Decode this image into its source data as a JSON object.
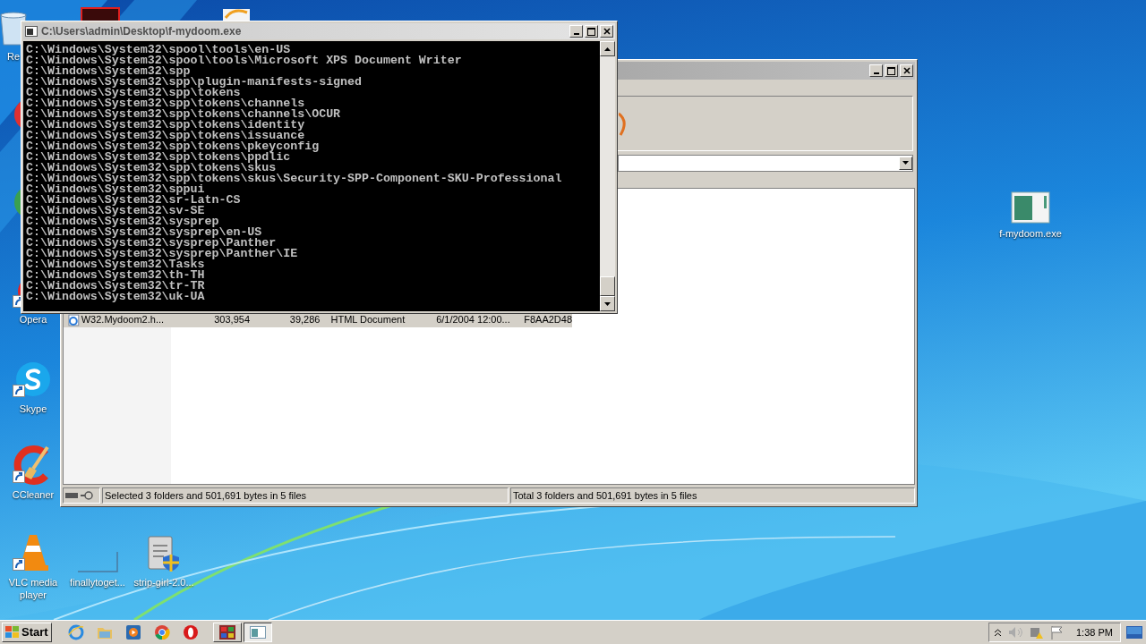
{
  "desktop_icons": [
    {
      "kind": "bin",
      "label": "Re"
    },
    {
      "kind": "opera",
      "label": "Opera"
    },
    {
      "kind": "skype",
      "label": "Skype"
    },
    {
      "kind": "ccleaner",
      "label": "CCleaner"
    },
    {
      "kind": "vlc",
      "label": "VLC media player"
    },
    {
      "kind": "blank",
      "label": "finallytoget..."
    },
    {
      "kind": "notepad",
      "label": "strip-girl-2.0..."
    },
    {
      "kind": "exe",
      "label": "f-mydoom.exe"
    }
  ],
  "file_window": {
    "rows": [
      {
        "selected": true,
        "name": "W32.Mydoom2.h...",
        "size": "303,954",
        "packed": "39,286",
        "type": "HTML Document",
        "date": "6/1/2004 12:00...",
        "crc": "F8AA2D48"
      }
    ],
    "status_bar": [
      "Selected 3 folders and 501,691 bytes in 5 files",
      "Total 3 folders and 501,691 bytes in 5 files"
    ]
  },
  "console": {
    "title": "C:\\Users\\admin\\Desktop\\f-mydoom.exe",
    "lines": [
      "C:\\Windows\\System32\\spool\\tools\\en-US",
      "C:\\Windows\\System32\\spool\\tools\\Microsoft XPS Document Writer",
      "C:\\Windows\\System32\\spp",
      "C:\\Windows\\System32\\spp\\plugin-manifests-signed",
      "C:\\Windows\\System32\\spp\\tokens",
      "C:\\Windows\\System32\\spp\\tokens\\channels",
      "C:\\Windows\\System32\\spp\\tokens\\channels\\OCUR",
      "C:\\Windows\\System32\\spp\\tokens\\identity",
      "C:\\Windows\\System32\\spp\\tokens\\issuance",
      "C:\\Windows\\System32\\spp\\tokens\\pkeyconfig",
      "C:\\Windows\\System32\\spp\\tokens\\ppdlic",
      "C:\\Windows\\System32\\spp\\tokens\\skus",
      "C:\\Windows\\System32\\spp\\tokens\\skus\\Security-SPP-Component-SKU-Professional",
      "C:\\Windows\\System32\\sppui",
      "C:\\Windows\\System32\\sr-Latn-CS",
      "C:\\Windows\\System32\\sv-SE",
      "C:\\Windows\\System32\\sysprep",
      "C:\\Windows\\System32\\sysprep\\en-US",
      "C:\\Windows\\System32\\sysprep\\Panther",
      "C:\\Windows\\System32\\sysprep\\Panther\\IE",
      "C:\\Windows\\System32\\Tasks",
      "C:\\Windows\\System32\\th-TH",
      "C:\\Windows\\System32\\tr-TR",
      "C:\\Windows\\System32\\uk-UA"
    ]
  },
  "taskbar": {
    "start": "Start",
    "tasks": [
      {
        "kind": "grid",
        "selected": false
      },
      {
        "kind": "window",
        "selected": true
      }
    ],
    "clock": "1:38 PM"
  }
}
